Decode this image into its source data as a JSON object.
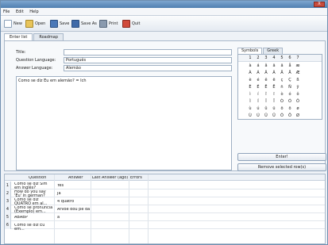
{
  "window": {
    "title": "",
    "close_label": "X"
  },
  "menu": [
    "File",
    "Edit",
    "Help"
  ],
  "toolbar": [
    {
      "id": "new",
      "label": "New",
      "icon": "new-file-icon"
    },
    {
      "id": "open",
      "label": "Open",
      "icon": "open-folder-icon"
    },
    {
      "id": "save",
      "label": "Save",
      "icon": "save-icon"
    },
    {
      "id": "saveas",
      "label": "Save As",
      "icon": "save-as-icon"
    },
    {
      "id": "print",
      "label": "Print",
      "icon": "print-icon"
    },
    {
      "id": "quit",
      "label": "Quit",
      "icon": "quit-icon"
    }
  ],
  "tabs": [
    {
      "label": "Enter list",
      "active": true
    },
    {
      "label": "Roadmap",
      "active": false
    }
  ],
  "form": {
    "title_label": "Title:",
    "title_value": "",
    "question_lang_label": "Question Language:",
    "question_lang_value": "Português",
    "answer_lang_label": "Answer Language:",
    "answer_lang_value": "Alemão"
  },
  "editor": {
    "text": "Como se diz Eu em alemão? = Ich"
  },
  "chars": {
    "tabs": [
      {
        "label": "Symbols",
        "active": true
      },
      {
        "label": "Greek",
        "active": false
      }
    ],
    "columns": [
      "1",
      "2",
      "3",
      "4",
      "5",
      "6",
      "7"
    ],
    "rows": [
      {
        "h": "",
        "c": [
          "à",
          "á",
          "â",
          "ã",
          "ä",
          "å",
          "æ"
        ]
      },
      {
        "h": "",
        "c": [
          "À",
          "Á",
          "Â",
          "Ã",
          "Ä",
          "Å",
          "Æ"
        ]
      },
      {
        "h": "",
        "c": [
          "è",
          "é",
          "ê",
          "ë",
          "ç",
          "Ç",
          "ß"
        ]
      },
      {
        "h": "",
        "c": [
          "È",
          "É",
          "Ê",
          "Ë",
          "ñ",
          "Ñ",
          "ÿ"
        ]
      },
      {
        "h": "",
        "c": [
          "ì",
          "í",
          "î",
          "ï",
          "ò",
          "ó",
          "ô"
        ]
      },
      {
        "h": "",
        "c": [
          "Ì",
          "Í",
          "Î",
          "Ï",
          "Ò",
          "Ó",
          "Ô"
        ]
      },
      {
        "h": "",
        "c": [
          "ù",
          "ú",
          "û",
          "ü",
          "õ",
          "ö",
          "ø"
        ]
      },
      {
        "h": "",
        "c": [
          "Ù",
          "Ú",
          "Û",
          "Ü",
          "Õ",
          "Ö",
          "Ø"
        ]
      }
    ]
  },
  "buttons": {
    "enter": "Enter!",
    "remove": "Remove selected row(s)"
  },
  "grid": {
    "headers": [
      "Question",
      "Answer",
      "Last Answer (ago)",
      "Errors"
    ],
    "rows": [
      {
        "n": "1",
        "q": "Como se diz Sim em inglês?",
        "a": "Yes",
        "l": "",
        "e": ""
      },
      {
        "n": "2",
        "q": "How do you say 'Eu' in german?",
        "a": "Ja",
        "l": "",
        "e": ""
      },
      {
        "n": "3",
        "q": "Como se diz QUATRO em al...",
        "a": "4 quatro",
        "l": "",
        "e": ""
      },
      {
        "n": "4",
        "q": "Como se pronuncia (Exemplo) em...",
        "a": "Árvoe dou pé dá",
        "l": "",
        "e": ""
      },
      {
        "n": "5",
        "q": "ABABP",
        "a": "a",
        "l": "",
        "e": ""
      },
      {
        "n": "6",
        "q": "Como se diz Eu em...",
        "a": "",
        "l": "",
        "e": ""
      }
    ]
  }
}
